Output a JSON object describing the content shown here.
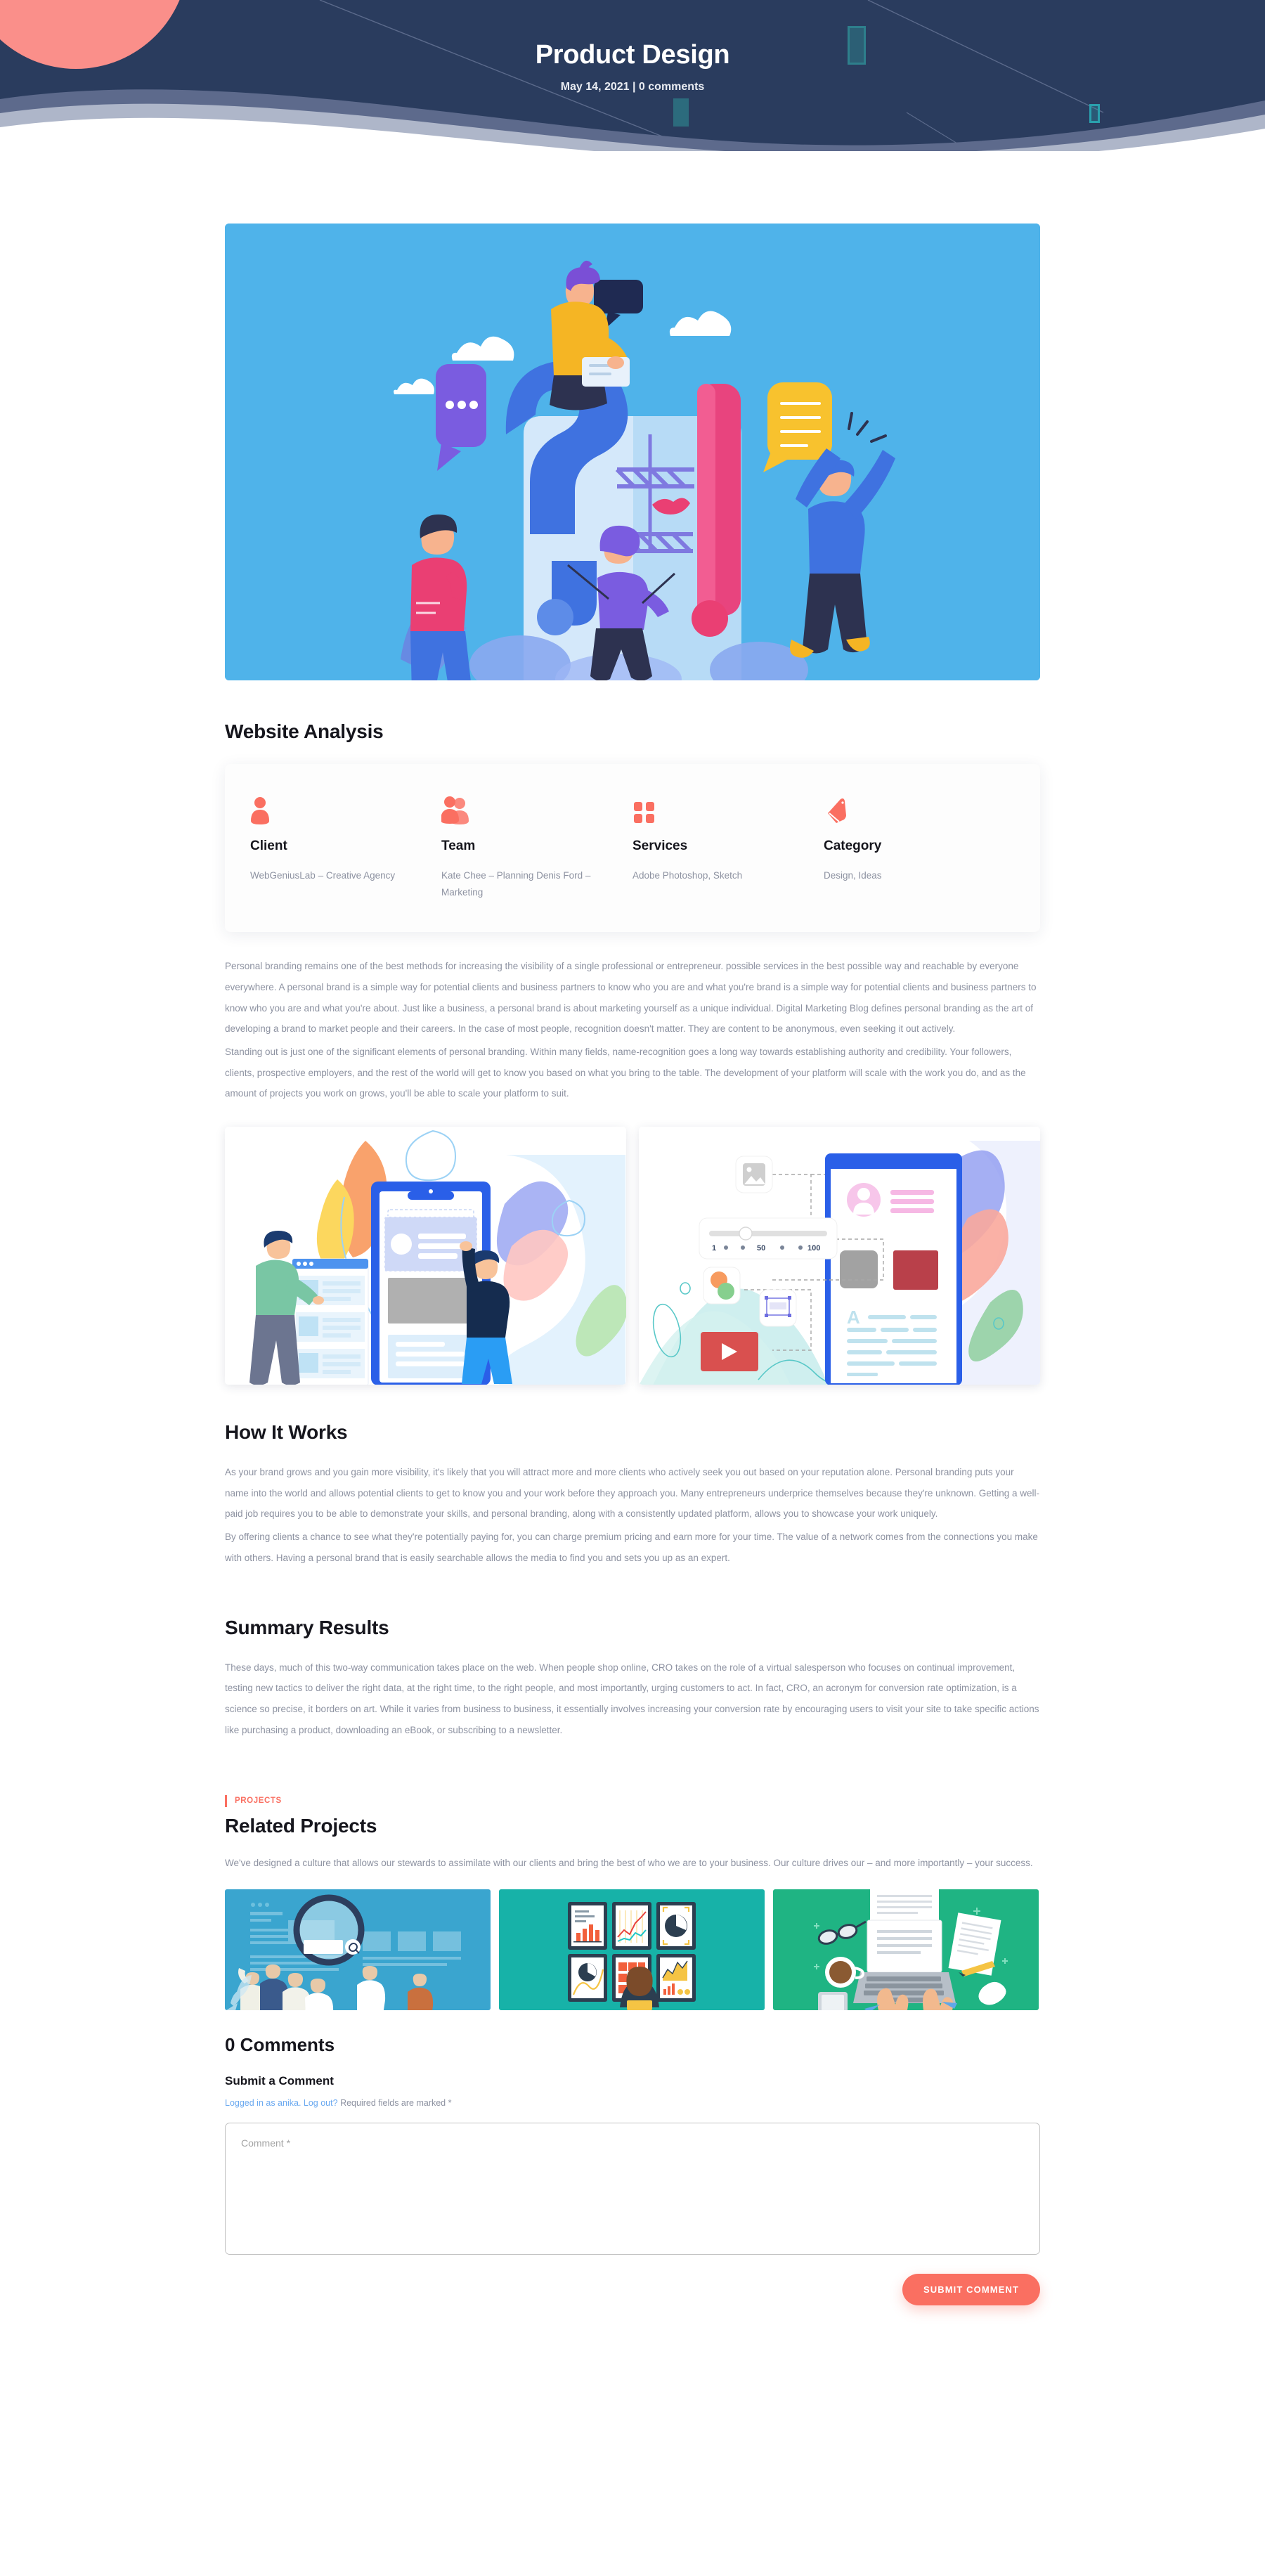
{
  "theme": {
    "hero_bg": "#2a3c5e",
    "accent": "#fa6f61",
    "salmon": "#fa8f8a",
    "wave_dark": "#5d6a8c",
    "wave_light": "#aeb6c9",
    "text_dark": "#16161d",
    "text_muted": "#8d92a1",
    "link_blue": "#6aa9f0"
  },
  "hero": {
    "title": "Product Design",
    "meta": "May 14, 2021 | 0 comments"
  },
  "featured_image": {
    "alt": "question-exclamation-illustration",
    "bg": "#4fb3ea"
  },
  "website_analysis": {
    "heading": "Website Analysis",
    "items": [
      {
        "icon": "client-person-icon",
        "label": "Client",
        "value": "WebGeniusLab – Creative Agency"
      },
      {
        "icon": "team-people-icon",
        "label": "Team",
        "value": "Kate Chee – Planning Denis Ford – Marketing"
      },
      {
        "icon": "services-grid-icon",
        "label": "Services",
        "value": "Adobe Photoshop, Sketch"
      },
      {
        "icon": "category-tag-icon",
        "label": "Category",
        "value": "Design, Ideas"
      }
    ]
  },
  "intro": {
    "paragraph_1": "Personal branding remains one of the best methods for increasing the visibility of a single professional or entrepreneur. possible services in the best possible way and reachable by everyone everywhere. A personal brand is a simple way for potential clients and business partners to know who you are and what you're brand is a simple way for potential clients and business partners to know who you are and what you're about. Just like a business, a personal brand is about marketing yourself as a unique individual. Digital Marketing Blog defines personal branding as the art of developing a brand to market people and their careers. In the case of most people, recognition doesn't matter. They are content to be anonymous, even seeking it out actively.",
    "paragraph_2": "Standing out is just one of the significant elements of personal branding. Within many fields, name-recognition goes a long way towards establishing authority and credibility. Your followers, clients, prospective employers, and the rest of the world will get to know you based on what you bring to the table. The development of your platform will scale with the work you do, and as the amount of projects you work on grows, you'll be able to scale your platform to suit."
  },
  "gallery": [
    {
      "alt": "ui-design-collaboration-illustration"
    },
    {
      "alt": "mobile-content-editor-illustration"
    }
  ],
  "how_it_works": {
    "heading": "How It Works",
    "paragraph_1": "As your brand grows and you gain more visibility, it's likely that you will attract more and more clients who actively seek you out based on your reputation alone. Personal branding puts your name into the world and allows potential clients to get to know you and your work before they approach you. Many entrepreneurs underprice themselves because they're unknown. Getting a well-paid job requires you to be able to demonstrate your skills, and personal branding, along with a consistently updated platform, allows you to showcase your work uniquely.",
    "paragraph_2": "By offering clients a chance to see what they're potentially paying for, you can charge premium pricing and earn more for your time. The value of a network comes from the connections you make with others. Having a personal brand that is easily searchable allows the media to find you and sets you up as an expert."
  },
  "summary_results": {
    "heading": "Summary Results",
    "paragraph_1": "These days, much of this two-way communication takes place on the web. When people shop online, CRO takes on the role of a virtual salesperson who focuses on continual improvement, testing new tactics to deliver the right data, at the right time, to the right people, and most importantly, urging customers to act. In fact, CRO, an acronym for conversion rate optimization, is a science so precise, it borders on art. While it varies from business to business, it essentially involves increasing your conversion rate by encouraging users to visit your site to take specific actions like purchasing a product, downloading an eBook, or subscribing to a newsletter."
  },
  "related_projects": {
    "eyebrow": "PROJECTS",
    "heading": "Related Projects",
    "description": "We've designed a culture that allows our stewards to assimilate with our clients and bring the best of who we are to your business. Our culture drives our – and more importantly – your success.",
    "items": [
      {
        "alt": "team-magnifier-search-illustration",
        "bg": "#3aa5cf"
      },
      {
        "alt": "analytics-dashboard-screens-illustration",
        "bg": "#17b2a8"
      },
      {
        "alt": "desk-laptop-top-view-illustration",
        "bg": "#1fb483"
      }
    ]
  },
  "comments": {
    "count_heading": "0 Comments",
    "submit_heading": "Submit a Comment",
    "logged_in_prefix": "Logged in as anika.",
    "logout_label": "Log out?",
    "required_note": "Required fields are marked *",
    "comment_placeholder": "Comment *",
    "comment_value": "",
    "submit_label": "SUBMIT COMMENT"
  }
}
